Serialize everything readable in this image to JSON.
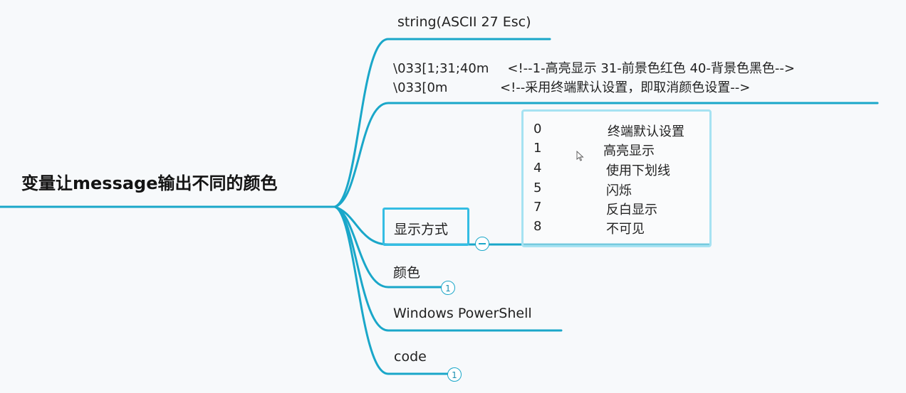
{
  "mindmap": {
    "root_title": "变量让message输出不同的颜色",
    "branches": {
      "string": {
        "label": "string(ASCII 27 Esc)"
      },
      "example": {
        "lines": [
          {
            "code": "\\033[1;31;40m",
            "comment": "<!--1-高亮显示 31-前景色红色  40-背景色黑色-->"
          },
          {
            "code": "\\033[0m",
            "comment": "<!--采用终端默认设置，即取消颜色设置-->"
          }
        ]
      },
      "display_mode": {
        "label": "显示方式",
        "options": [
          {
            "code": "0",
            "desc": "终端默认设置"
          },
          {
            "code": "1",
            "desc": "高亮显示"
          },
          {
            "code": "4",
            "desc": "使用下划线"
          },
          {
            "code": "5",
            "desc": "闪烁"
          },
          {
            "code": "7",
            "desc": "反白显示"
          },
          {
            "code": "8",
            "desc": "不可见"
          }
        ]
      },
      "color": {
        "label": "颜色",
        "collapsed_count": "1"
      },
      "powershell": {
        "label": "Windows PowerShell"
      },
      "code": {
        "label": "code",
        "collapsed_count": "1"
      }
    }
  },
  "colors": {
    "branch_line": "#1aa7c9",
    "selected_border": "#34bde3",
    "table_border": "#a6e2f2",
    "background": "#f7f9fb"
  }
}
